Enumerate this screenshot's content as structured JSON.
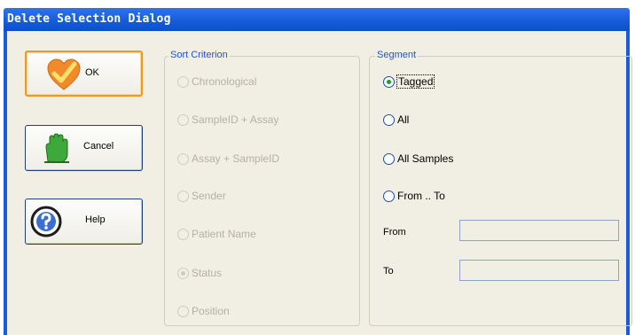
{
  "window": {
    "title": "Delete Selection Dialog"
  },
  "buttons": {
    "ok": {
      "label": "OK",
      "icon": "checkmark-heart-icon"
    },
    "cancel": {
      "label": "Cancel",
      "icon": "stop-hand-icon"
    },
    "help": {
      "label": "Help",
      "icon": "question-icon"
    }
  },
  "sort_criterion": {
    "legend": "Sort Criterion",
    "enabled": false,
    "selected": "Status",
    "options": [
      "Chronological",
      "SampleID + Assay",
      "Assay + SampleID",
      "Sender",
      "Patient Name",
      "Status",
      "Position"
    ]
  },
  "segment": {
    "legend": "Segment",
    "selected": "Tagged",
    "options": [
      "Tagged",
      "All",
      "All Samples",
      "From .. To"
    ],
    "from": {
      "label": "From",
      "value": ""
    },
    "to": {
      "label": "To",
      "value": ""
    }
  },
  "colors": {
    "titlebar": "#155ad8",
    "dialog_bg": "#f1efe3",
    "legend_text": "#1f55cf",
    "ok_border": "#e89a2c",
    "selected_dot": "#1e9a2a"
  }
}
